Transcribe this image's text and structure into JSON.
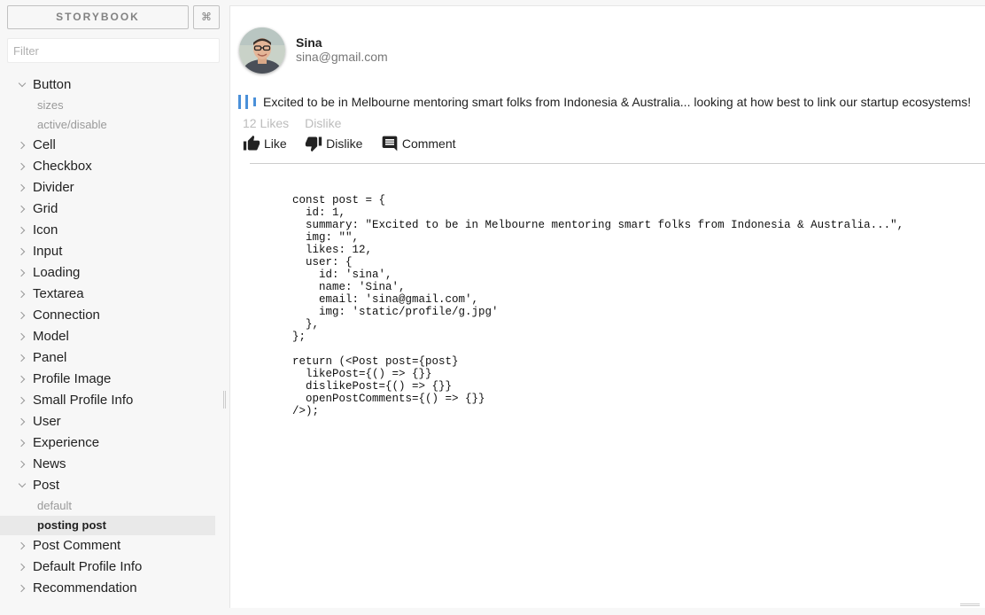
{
  "sidebar": {
    "brand": "STORYBOOK",
    "shortcut": "⌘",
    "filter_placeholder": "Filter",
    "items": {
      "button": {
        "label": "Button",
        "subs": {
          "sizes": "sizes",
          "active_disable": "active/disable"
        }
      },
      "cell": "Cell",
      "checkbox": "Checkbox",
      "divider": "Divider",
      "grid": "Grid",
      "icon": "Icon",
      "input": "Input",
      "loading": "Loading",
      "textarea": "Textarea",
      "connection": "Connection",
      "model": "Model",
      "panel": "Panel",
      "profile_image": "Profile Image",
      "small_profile_info": "Small Profile Info",
      "user": "User",
      "experience": "Experience",
      "news": "News",
      "post": {
        "label": "Post",
        "subs": {
          "default": "default",
          "posting_post": "posting post"
        }
      },
      "post_comment": "Post Comment",
      "default_profile_info": "Default Profile Info",
      "recommendation": "Recommendation"
    }
  },
  "post": {
    "user_name": "Sina",
    "user_email": "sina@gmail.com",
    "summary": "Excited to be in Melbourne mentoring smart folks from Indonesia & Australia... looking at how best to link our startup ecosystems!",
    "likes_text": "12 Likes",
    "dislike_text": "Dislike",
    "actions": {
      "like": "Like",
      "dislike": "Dislike",
      "comment": "Comment"
    }
  },
  "code": "const post = {\n  id: 1,\n  summary: \"Excited to be in Melbourne mentoring smart folks from Indonesia & Australia...\",\n  img: \"\",\n  likes: 12,\n  user: {\n    id: 'sina',\n    name: 'Sina',\n    email: 'sina@gmail.com',\n    img: 'static/profile/g.jpg'\n  },\n};\n\nreturn (<Post post={post}\n  likePost={() => {}}\n  dislikePost={() => {}}\n  openPostComments={() => {}}\n/>);",
  "colors": {
    "accent": "#4a90d9",
    "muted": "#bcbcbc",
    "sidebar_bg": "#f7f7f7"
  }
}
